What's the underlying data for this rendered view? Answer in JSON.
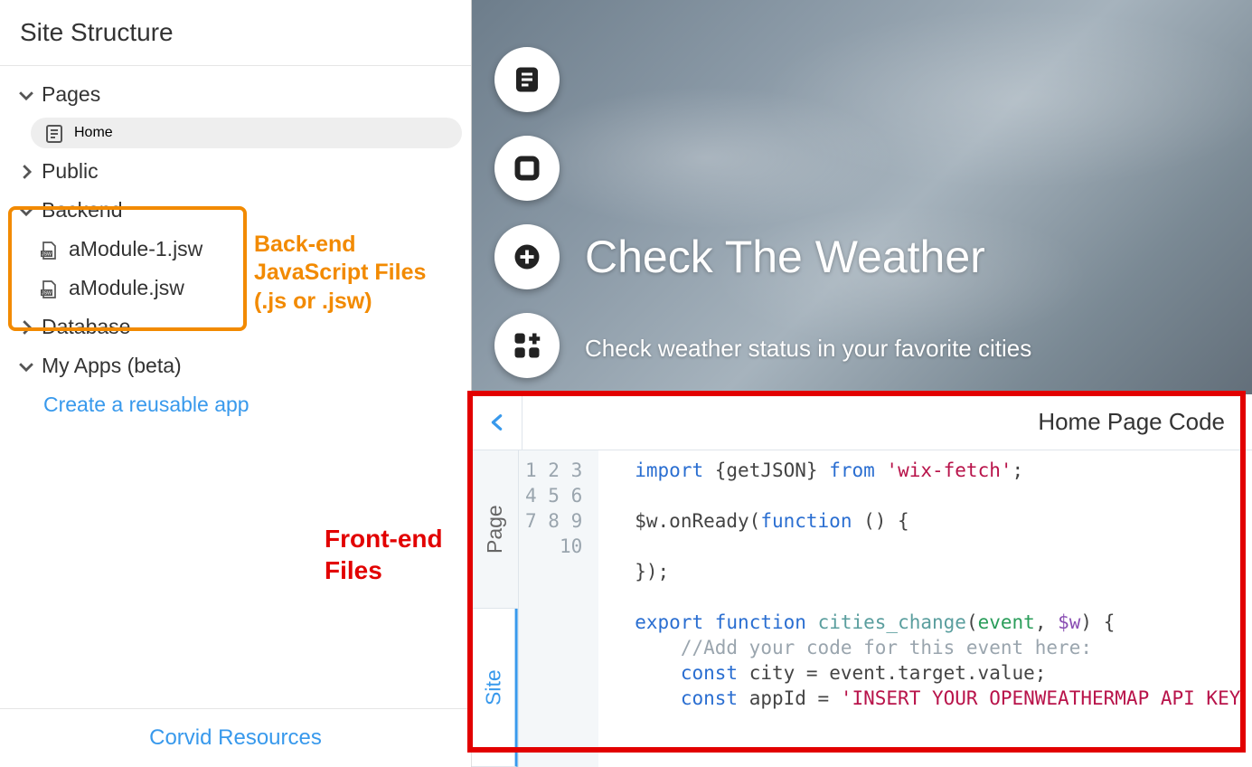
{
  "sidebar": {
    "header": "Site Structure",
    "pages": {
      "label": "Pages",
      "items": [
        "Home"
      ]
    },
    "public": {
      "label": "Public"
    },
    "backend": {
      "label": "Backend",
      "files": [
        "aModule-1.jsw",
        "aModule.jsw"
      ]
    },
    "database": {
      "label": "Database"
    },
    "myapps": {
      "label": "My Apps (beta)",
      "link": "Create a reusable app"
    },
    "footer": "Corvid Resources"
  },
  "annotations": {
    "backend": "Back-end JavaScript Files (.js or .jsw)",
    "frontend": "Front-end Files"
  },
  "preview": {
    "title": "Check The Weather",
    "subtitle": "Check weather status in your favorite cities"
  },
  "code_panel": {
    "title": "Home Page Code",
    "tabs": [
      "Page",
      "Site"
    ],
    "lines": [
      "1",
      "2",
      "3",
      "4",
      "5",
      "6",
      "7",
      "8",
      "9",
      "10"
    ],
    "code": {
      "l1_pre": "import ",
      "l1_obj": "{getJSON}",
      "l1_from": " from ",
      "l1_str": "'wix-fetch'",
      "l1_end": ";",
      "l3_pre": "$w.onReady(",
      "l3_fn": "function",
      "l3_mid": " () {",
      "l5": "});",
      "l7_exp": "export ",
      "l7_fn": "function ",
      "l7_name": "cities_change",
      "l7_op": "(",
      "l7_a1": "event",
      "l7_c": ", ",
      "l7_a2": "$w",
      "l7_cl": ") {",
      "l8_indent": "    ",
      "l8_cm": "//Add your code for this event here:",
      "l9_indent": "    ",
      "l9_kw": "const",
      "l9_rest": " city = event.target.value;",
      "l10_indent": "    ",
      "l10_kw": "const",
      "l10_mid": " appId = ",
      "l10_str": "'INSERT YOUR OPENWEATHERMAP API KEY "
    }
  }
}
